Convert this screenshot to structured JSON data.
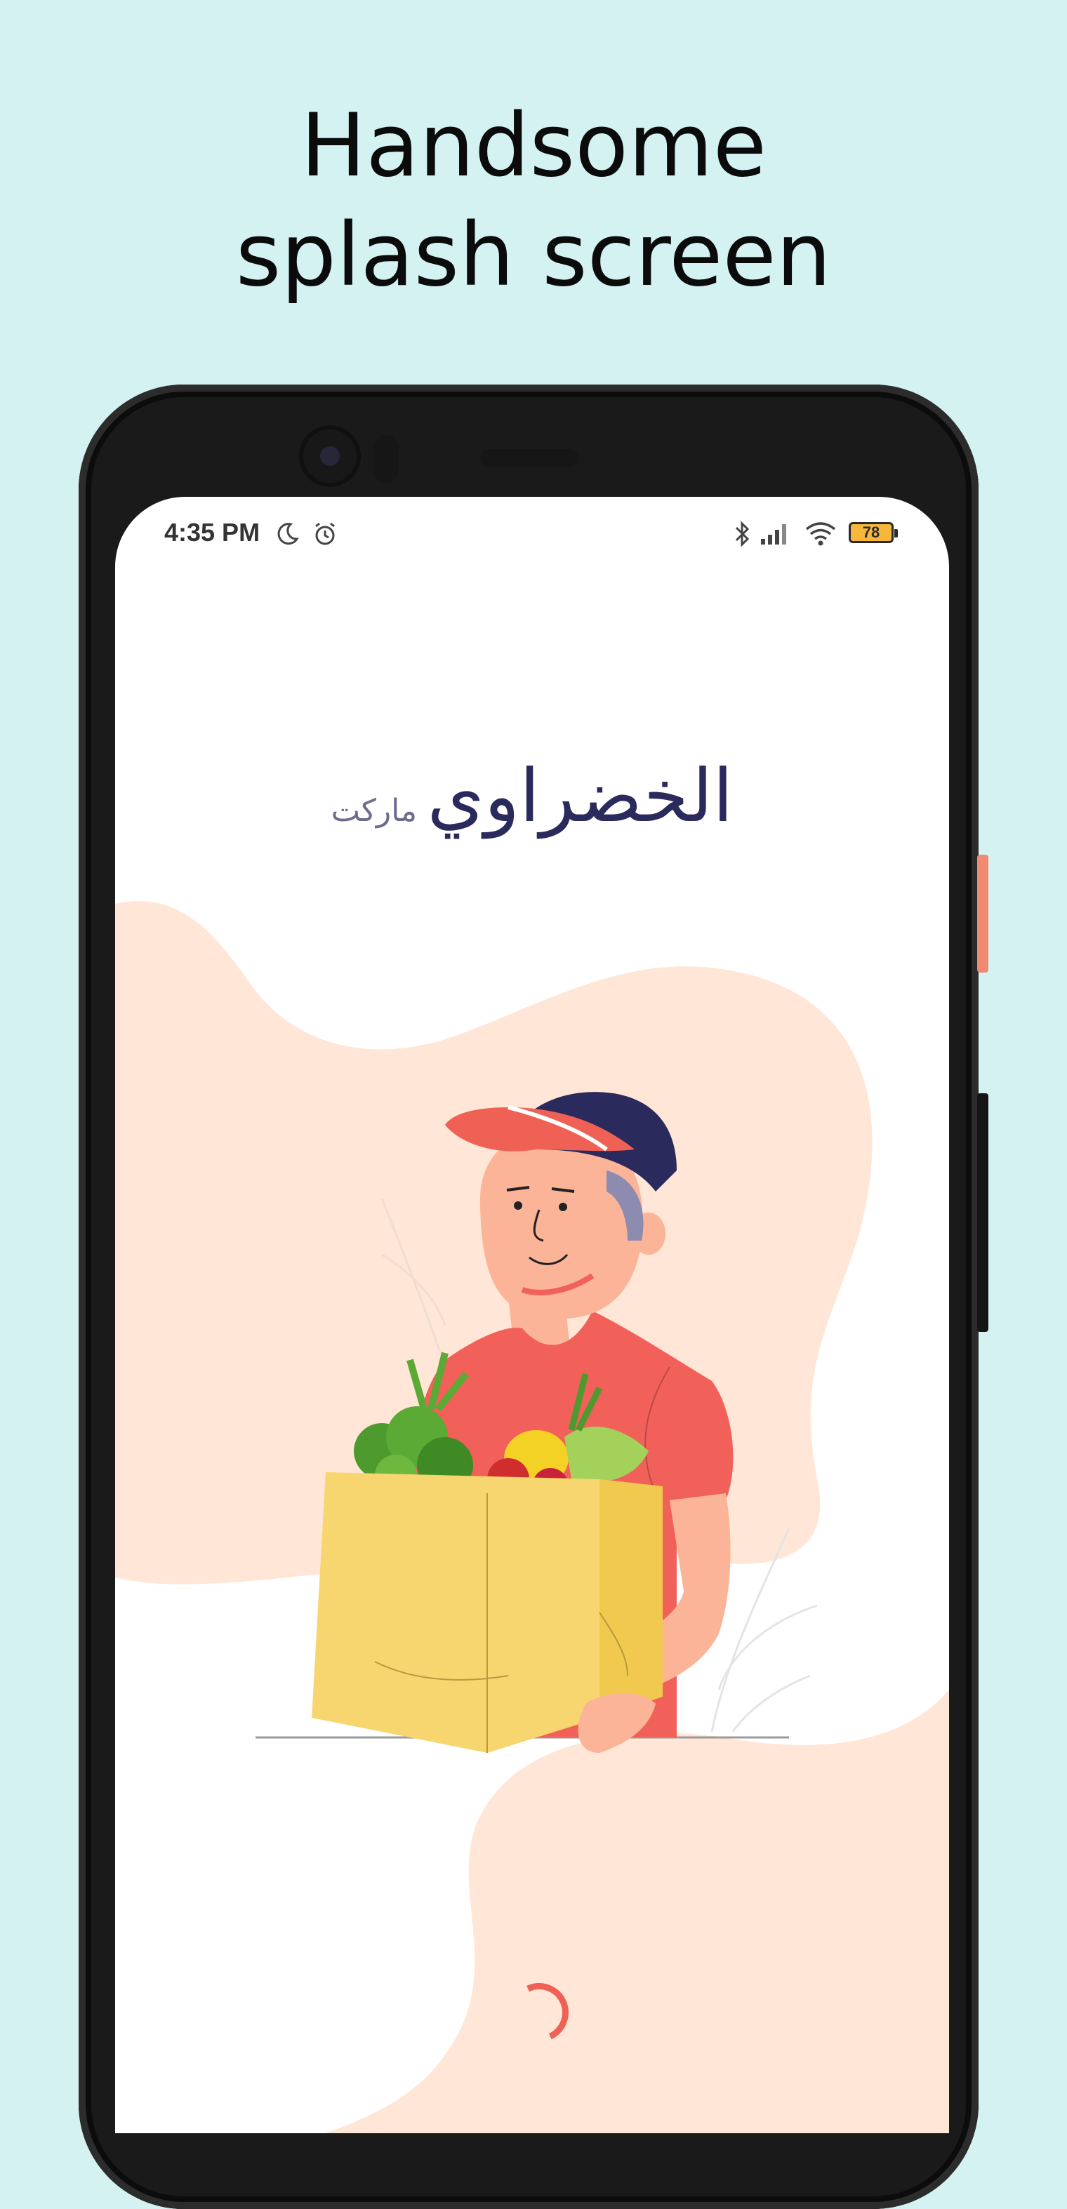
{
  "headline": {
    "line1": "Handsome",
    "line2": "splash screen"
  },
  "status_bar": {
    "time": "4:35 PM",
    "icons": [
      "moon-icon",
      "alarm-icon",
      "bluetooth-icon",
      "signal-icon",
      "wifi-icon"
    ],
    "battery_level": "78"
  },
  "app": {
    "logo_main": "الخضراوي",
    "logo_sub": "ماركت"
  },
  "colors": {
    "background": "#d4f2f1",
    "blob": "#ffe6d6",
    "accent": "#ef6155",
    "logo": "#2b2a5c",
    "bag": "#f7d670"
  }
}
